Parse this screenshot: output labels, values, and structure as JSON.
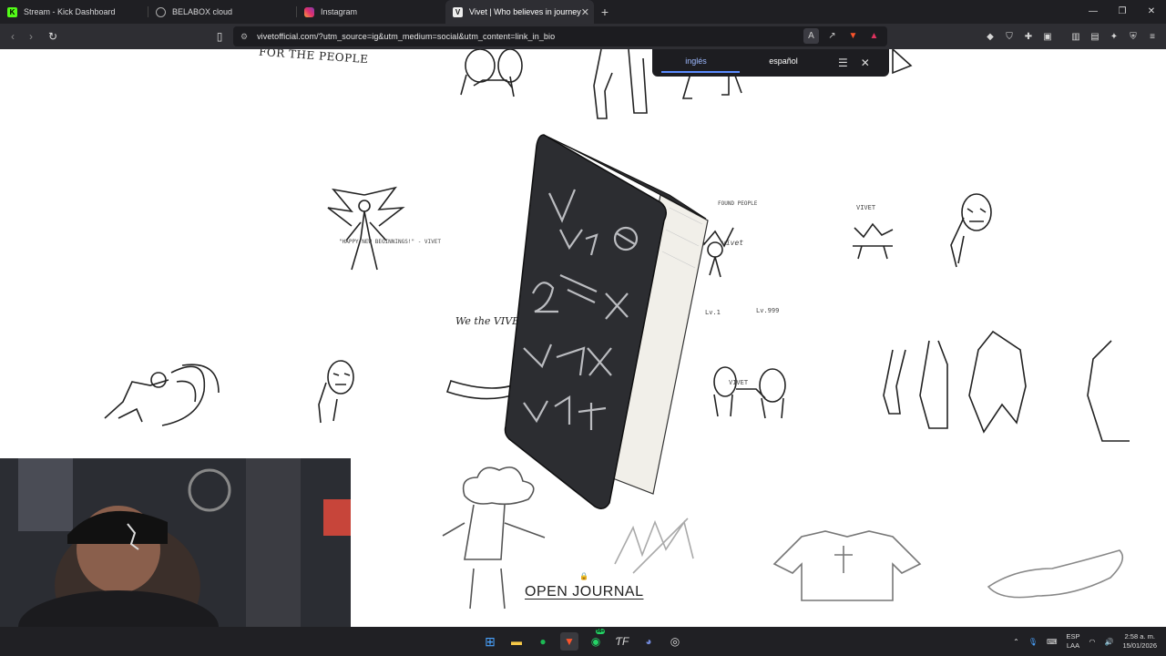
{
  "browser": {
    "tabs": [
      {
        "title": "Stream - Kick Dashboard",
        "favicon_color": "#53fc18",
        "active": false
      },
      {
        "title": "BELABOX cloud",
        "favicon_color": "#888888",
        "active": false
      },
      {
        "title": "Instagram",
        "favicon_color": "#e1306c",
        "active": false
      },
      {
        "title": "Vivet | Who believes in journey",
        "favicon_color": "#dddddd",
        "active": true
      }
    ],
    "new_tab_icon": "+",
    "address": "vivetofficial.com/?utm_source=ig&utm_medium=social&utm_content=link_in_bio"
  },
  "translate_popup": {
    "options": [
      "inglés",
      "español"
    ],
    "selected": "inglés"
  },
  "page": {
    "tagline": "FOR THE PEOPLE",
    "captions": {
      "angel": "\"HAPPY NEW BEGINNINGS!\" - VIVET",
      "banner": "We the VIVET",
      "levels_left": "Lv.1",
      "levels_right": "Lv.999",
      "found_people": "FOUND PEOPLE",
      "brand": "VIVET",
      "brand2": "VIVET",
      "subtext": "vivet"
    },
    "book_cover_text": "VIVET",
    "open_journal_label": "OPEN JOURNAL"
  },
  "taskbar": {
    "language_line1": "ESP",
    "language_line2": "LAA",
    "time": "2:58 a. m.",
    "date": "15/01/2026",
    "badge_count": "99+"
  }
}
